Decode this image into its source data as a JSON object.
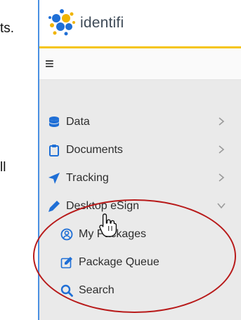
{
  "background": {
    "text_line_1": "ts.",
    "text_line_2": "ll"
  },
  "brand": {
    "name": "identifi"
  },
  "menu": {
    "items": [
      {
        "label": "Data",
        "icon": "database-icon"
      },
      {
        "label": "Documents",
        "icon": "clipboard-icon"
      },
      {
        "label": "Tracking",
        "icon": "location-arrow-icon"
      },
      {
        "label": "Desktop eSign",
        "icon": "pencil-icon"
      }
    ],
    "subitems": [
      {
        "label": "My Packages",
        "icon": "user-circle-icon"
      },
      {
        "label": "Package Queue",
        "icon": "edit-icon"
      },
      {
        "label": "Search",
        "icon": "search-icon"
      }
    ]
  },
  "colors": {
    "accent_yellow": "#f5c518",
    "icon_blue": "#1f6fd6",
    "annotation_red": "#b81a1a",
    "menu_bg": "#eaeaea"
  }
}
